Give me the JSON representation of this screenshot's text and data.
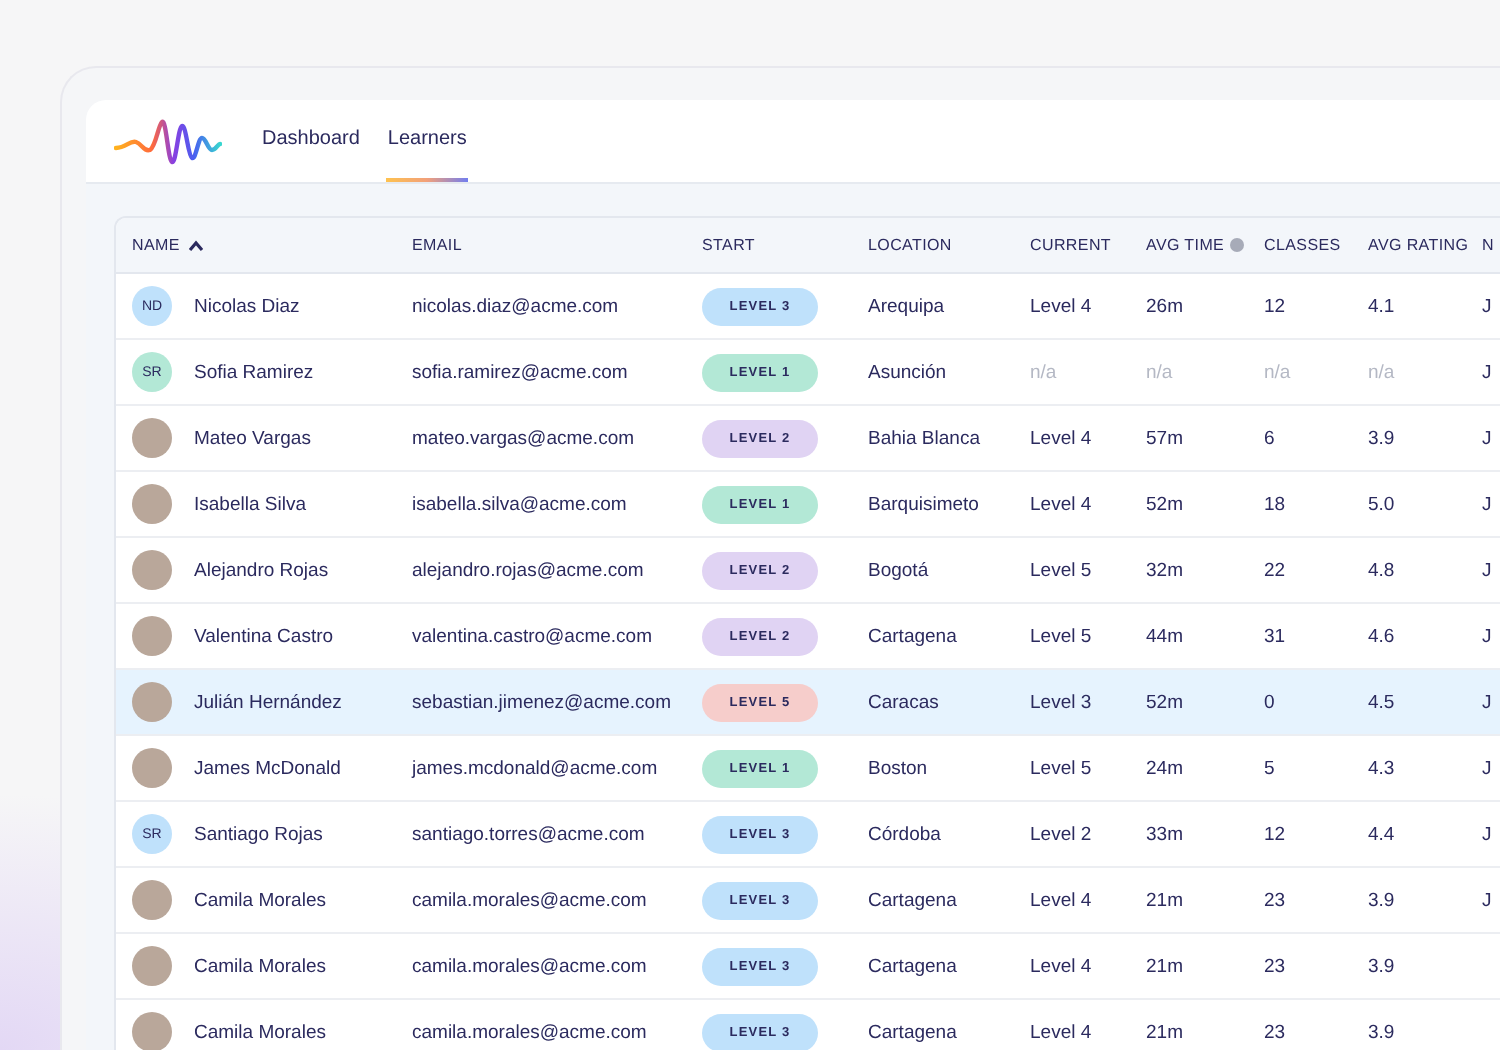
{
  "nav": {
    "tabs": [
      {
        "label": "Dashboard",
        "selected": false
      },
      {
        "label": "Learners",
        "selected": true
      }
    ]
  },
  "table": {
    "columns": [
      {
        "label": "NAME",
        "sorted": true,
        "info": false
      },
      {
        "label": "EMAIL",
        "sorted": false,
        "info": false
      },
      {
        "label": "START",
        "sorted": false,
        "info": false
      },
      {
        "label": "LOCATION",
        "sorted": false,
        "info": false
      },
      {
        "label": "CURRENT",
        "sorted": false,
        "info": false
      },
      {
        "label": "AVG TIME",
        "sorted": false,
        "info": true
      },
      {
        "label": "CLASSES",
        "sorted": false,
        "info": false
      },
      {
        "label": "AVG RATING",
        "sorted": false,
        "info": false
      },
      {
        "label": "N",
        "sorted": false,
        "info": false
      }
    ],
    "rows": [
      {
        "avatar": {
          "kind": "initials",
          "initials": "ND",
          "color": "#bfe1fb"
        },
        "name": "Nicolas Diaz",
        "email": "nicolas.diaz@acme.com",
        "start": {
          "label": "LEVEL 3",
          "color": "#bfe1fb"
        },
        "location": "Arequipa",
        "current": "Level 4",
        "avg_time": "26m",
        "classes": "12",
        "avg_rating": "4.1",
        "column_9": "J",
        "no_data": false,
        "selected": false
      },
      {
        "avatar": {
          "kind": "initials",
          "initials": "SR",
          "color": "#b3e8d6"
        },
        "name": "Sofia Ramirez",
        "email": "sofia.ramirez@acme.com",
        "start": {
          "label": "LEVEL 1",
          "color": "#b3e8d6"
        },
        "location": "Asunción",
        "current": "n/a",
        "avg_time": "n/a",
        "classes": "n/a",
        "avg_rating": "n/a",
        "column_9": "J",
        "no_data": true,
        "selected": false
      },
      {
        "avatar": {
          "kind": "photo"
        },
        "name": "Mateo Vargas",
        "email": "mateo.vargas@acme.com",
        "start": {
          "label": "LEVEL 2",
          "color": "#e0d3f3"
        },
        "location": "Bahia Blanca",
        "current": "Level 4",
        "avg_time": "57m",
        "classes": "6",
        "avg_rating": "3.9",
        "column_9": "J",
        "no_data": false,
        "selected": false
      },
      {
        "avatar": {
          "kind": "photo"
        },
        "name": "Isabella Silva",
        "email": "isabella.silva@acme.com",
        "start": {
          "label": "LEVEL 1",
          "color": "#b3e8d6"
        },
        "location": "Barquisimeto",
        "current": "Level 4",
        "avg_time": "52m",
        "classes": "18",
        "avg_rating": "5.0",
        "column_9": "J",
        "no_data": false,
        "selected": false
      },
      {
        "avatar": {
          "kind": "photo"
        },
        "name": "Alejandro Rojas",
        "email": "alejandro.rojas@acme.com",
        "start": {
          "label": "LEVEL 2",
          "color": "#e0d3f3"
        },
        "location": "Bogotá",
        "current": "Level 5",
        "avg_time": "32m",
        "classes": "22",
        "avg_rating": "4.8",
        "column_9": "J",
        "no_data": false,
        "selected": false
      },
      {
        "avatar": {
          "kind": "photo"
        },
        "name": "Valentina Castro",
        "email": "valentina.castro@acme.com",
        "start": {
          "label": "LEVEL 2",
          "color": "#e0d3f3"
        },
        "location": "Cartagena",
        "current": "Level 5",
        "avg_time": "44m",
        "classes": "31",
        "avg_rating": "4.6",
        "column_9": "J",
        "no_data": false,
        "selected": false
      },
      {
        "avatar": {
          "kind": "photo"
        },
        "name": "Julián Hernández",
        "email": "sebastian.jimenez@acme.com",
        "start": {
          "label": "LEVEL 5",
          "color": "#f6cdcb"
        },
        "location": "Caracas",
        "current": "Level 3",
        "avg_time": "52m",
        "classes": "0",
        "avg_rating": "4.5",
        "column_9": "J",
        "no_data": false,
        "selected": true
      },
      {
        "avatar": {
          "kind": "photo"
        },
        "name": "James McDonald",
        "email": "james.mcdonald@acme.com",
        "start": {
          "label": "LEVEL 1",
          "color": "#b3e8d6"
        },
        "location": "Boston",
        "current": "Level 5",
        "avg_time": "24m",
        "classes": "5",
        "avg_rating": "4.3",
        "column_9": "J",
        "no_data": false,
        "selected": false
      },
      {
        "avatar": {
          "kind": "initials",
          "initials": "SR",
          "color": "#bfe1fb"
        },
        "name": "Santiago Rojas",
        "email": "santiago.torres@acme.com",
        "start": {
          "label": "LEVEL 3",
          "color": "#bfe1fb"
        },
        "location": "Córdoba",
        "current": "Level 2",
        "avg_time": "33m",
        "classes": "12",
        "avg_rating": "4.4",
        "column_9": "J",
        "no_data": false,
        "selected": false
      },
      {
        "avatar": {
          "kind": "photo"
        },
        "name": "Camila Morales",
        "email": "camila.morales@acme.com",
        "start": {
          "label": "LEVEL 3",
          "color": "#bfe1fb"
        },
        "location": "Cartagena",
        "current": "Level 4",
        "avg_time": "21m",
        "classes": "23",
        "avg_rating": "3.9",
        "column_9": "J",
        "no_data": false,
        "selected": false
      },
      {
        "avatar": {
          "kind": "photo"
        },
        "name": "Camila Morales",
        "email": "camila.morales@acme.com",
        "start": {
          "label": "LEVEL 3",
          "color": "#bfe1fb"
        },
        "location": "Cartagena",
        "current": "Level 4",
        "avg_time": "21m",
        "classes": "23",
        "avg_rating": "3.9",
        "no_data": false,
        "selected": false
      },
      {
        "avatar": {
          "kind": "photo"
        },
        "name": "Camila Morales",
        "email": "camila.morales@acme.com",
        "start": {
          "label": "LEVEL 3",
          "color": "#bfe1fb"
        },
        "location": "Cartagena",
        "current": "Level 4",
        "avg_time": "21m",
        "classes": "23",
        "avg_rating": "3.9",
        "no_data": false,
        "selected": false
      }
    ]
  }
}
